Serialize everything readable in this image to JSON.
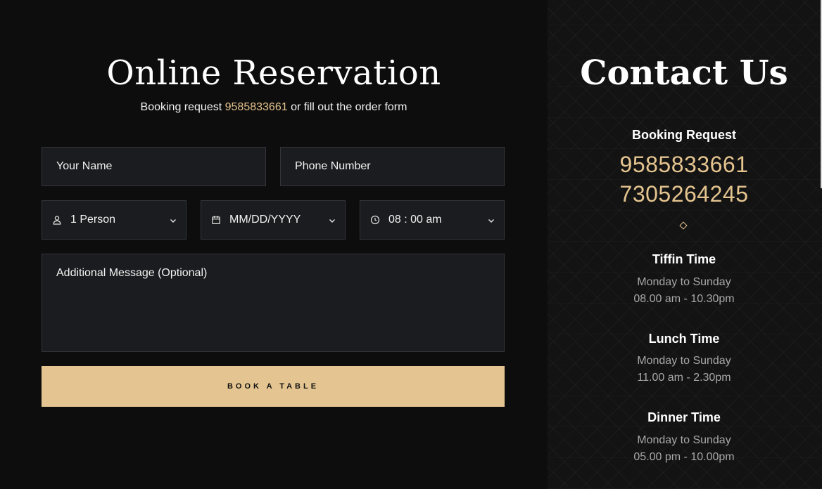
{
  "reservation": {
    "title": "Online Reservation",
    "subtitle_prefix": "Booking request",
    "subtitle_phone": "9585833661",
    "subtitle_suffix": "or fill out the order form",
    "name_placeholder": "Your Name",
    "phone_placeholder": "Phone Number",
    "persons_value": "1 Person",
    "date_value": "MM/DD/YYYY",
    "time_value": "08 : 00 am",
    "message_placeholder": "Additional Message (Optional)",
    "submit_label": "BOOK A TABLE",
    "icons": {
      "persons": "user-icon",
      "date": "calendar-icon",
      "time": "clock-icon",
      "dropdown": "chevron-down-icon"
    }
  },
  "contact": {
    "title": "Contact Us",
    "booking_heading": "Booking Request",
    "phones": [
      "9585833661",
      "7305264245"
    ],
    "divider_icon": "diamond-icon",
    "schedules": [
      {
        "heading": "Tiffin Time",
        "days": "Monday to Sunday",
        "hours": "08.00 am - 10.30pm"
      },
      {
        "heading": "Lunch Time",
        "days": "Monday to Sunday",
        "hours": "11.00 am - 2.30pm"
      },
      {
        "heading": "Dinner Time",
        "days": "Monday to Sunday",
        "hours": "05.00 pm - 10.00pm"
      }
    ]
  },
  "colors": {
    "background": "#0e0d0d",
    "field_background": "#1b1c1f",
    "accent_gold": "#e4c591"
  }
}
